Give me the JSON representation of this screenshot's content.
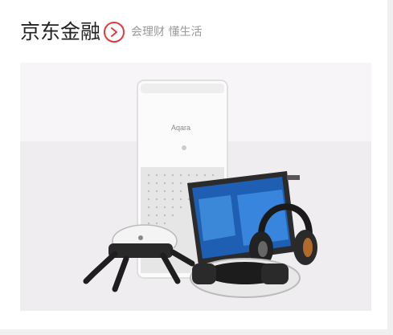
{
  "section": {
    "title": "京东金融",
    "subtitle": "会理财 懂生活",
    "arrow_icon": "chevron-right-circle-icon",
    "accent_color": "#e4393c"
  },
  "banner": {
    "product_brand_text": "Aqara",
    "product_icons": [
      "air-purifier-icon",
      "tablet-icon",
      "headphones-icon",
      "robot-icon",
      "vr-headset-icon"
    ]
  }
}
